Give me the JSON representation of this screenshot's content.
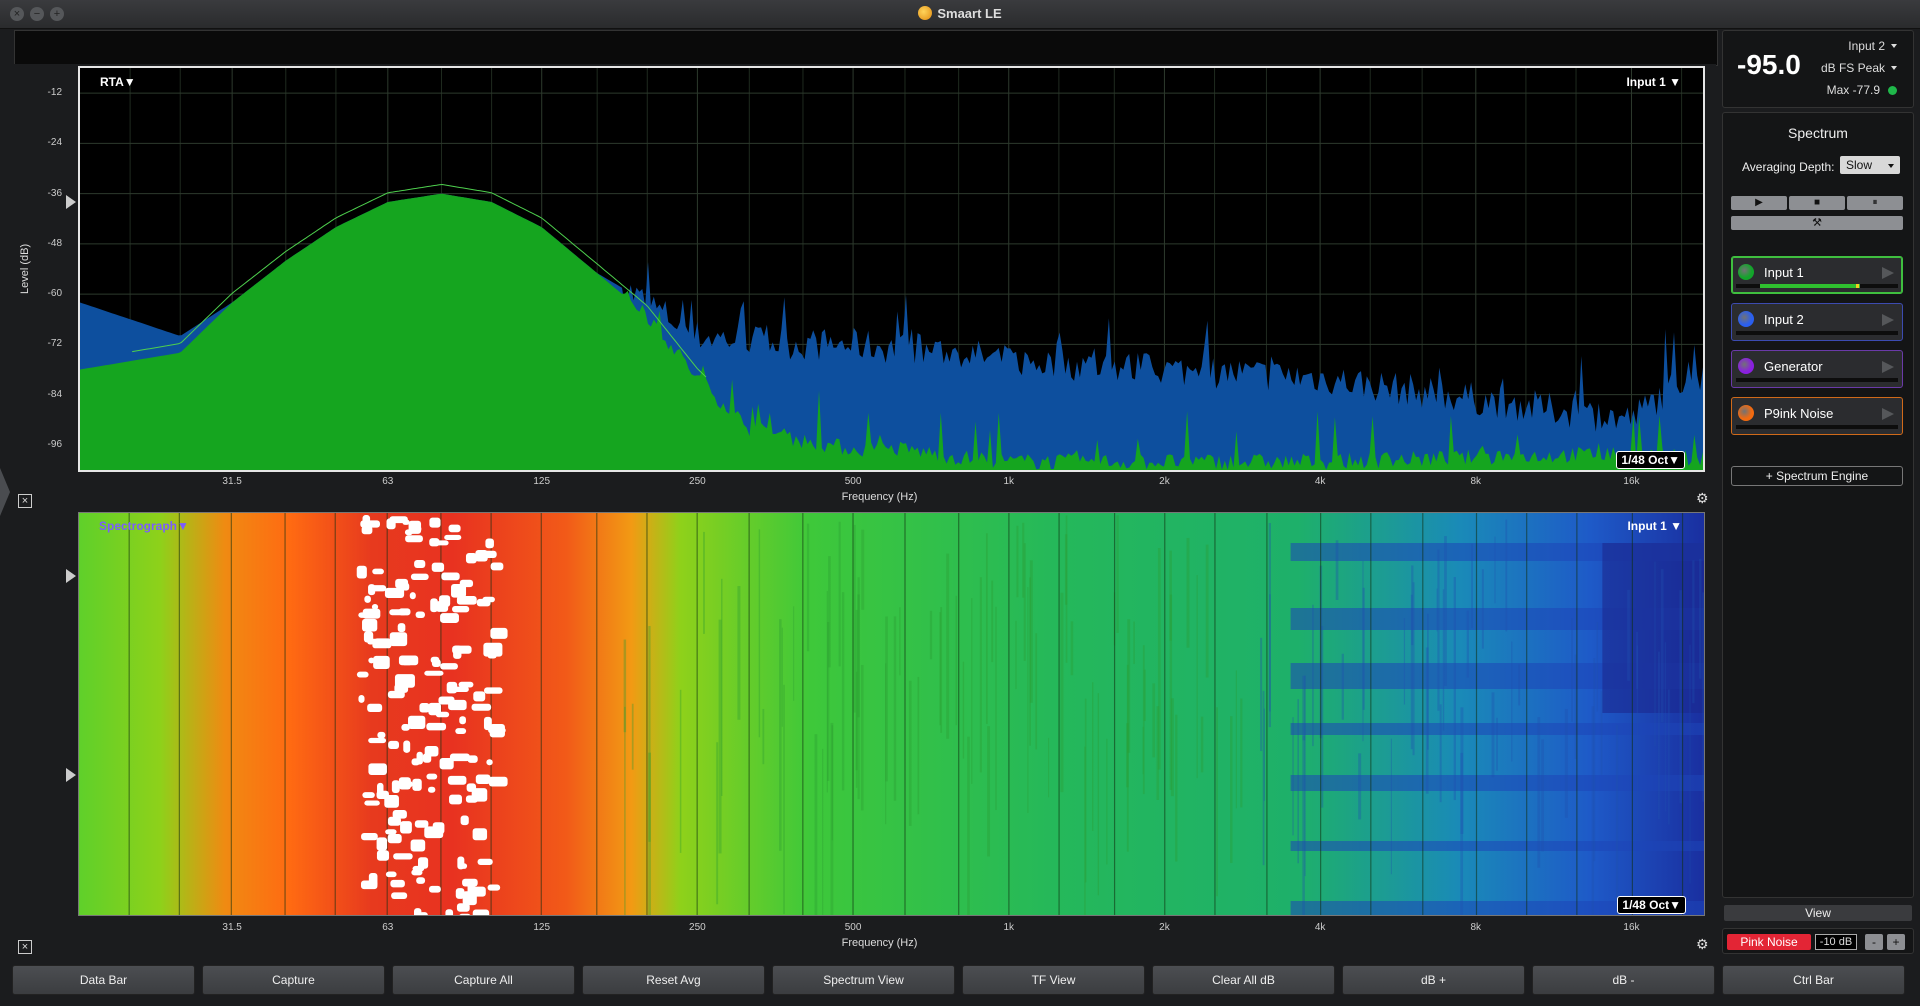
{
  "app": {
    "title": "Smaart LE"
  },
  "rta": {
    "mode_label": "RTA▼",
    "input_label": "Input 1 ▼",
    "resolution_label": "1/48 Oct▼",
    "y_axis_title": "Level (dB)",
    "x_axis_title": "Frequency (Hz)",
    "y_ticks": [
      "-12",
      "-24",
      "-36",
      "-48",
      "-60",
      "-72",
      "-84",
      "-96"
    ],
    "x_ticks": [
      "31.5",
      "63",
      "125",
      "250",
      "500",
      "1k",
      "2k",
      "4k",
      "8k",
      "16k"
    ]
  },
  "spectrograph": {
    "mode_label": "Spectrograph▼",
    "input_label": "Input 1 ▼",
    "resolution_label": "1/48 Oct▼",
    "x_axis_title": "Frequency (Hz)",
    "x_ticks": [
      "31.5",
      "63",
      "125",
      "250",
      "500",
      "1k",
      "2k",
      "4k",
      "8k",
      "16k"
    ]
  },
  "chart_data": [
    {
      "type": "area",
      "title": "RTA",
      "xlabel": "Frequency (Hz)",
      "ylabel": "Level (dB)",
      "xscale": "log",
      "xlim": [
        16,
        22000
      ],
      "ylim": [
        -102,
        -6
      ],
      "grid": true,
      "series": [
        {
          "name": "Input 1",
          "color": "#15a51f",
          "x": [
            16,
            25,
            31.5,
            40,
            50,
            63,
            80,
            100,
            125,
            160,
            200,
            250,
            315,
            400,
            500,
            630,
            800,
            1000,
            2000,
            4000,
            8000,
            16000,
            20000
          ],
          "values": [
            -78,
            -74,
            -62,
            -52,
            -44,
            -38,
            -36,
            -38,
            -44,
            -55,
            -65,
            -80,
            -92,
            -95,
            -97,
            -97,
            -99,
            -100,
            -100,
            -100,
            -99,
            -98,
            -99
          ]
        },
        {
          "name": "Input 2",
          "color": "#0d4f9e",
          "x": [
            16,
            25,
            31.5,
            40,
            50,
            63,
            80,
            100,
            125,
            160,
            200,
            250,
            315,
            400,
            500,
            630,
            800,
            1000,
            2000,
            4000,
            8000,
            16000,
            20000
          ],
          "values": [
            -62,
            -70,
            -62,
            -52,
            -44,
            -38,
            -36,
            -38,
            -44,
            -55,
            -62,
            -70,
            -71,
            -72,
            -72,
            -73,
            -74,
            -76,
            -78,
            -80,
            -85,
            -90,
            -80
          ]
        }
      ]
    },
    {
      "type": "heatmap",
      "title": "Spectrograph",
      "xlabel": "Frequency (Hz)",
      "xscale": "log",
      "xlim": [
        16,
        22000
      ],
      "x": [
        16,
        31.5,
        50,
        63,
        80,
        100,
        125,
        160,
        200,
        250,
        500,
        1000,
        2000,
        4000,
        8000,
        16000,
        20000
      ],
      "level_db": [
        -60,
        -50,
        -40,
        -33,
        -30,
        -36,
        -40,
        -45,
        -52,
        -60,
        -64,
        -66,
        -68,
        -72,
        -76,
        -84,
        -82
      ],
      "colors": [
        "#1a2fa0",
        "#1a8fd8",
        "#18c070",
        "#7ad11a",
        "#ff7a10",
        "#e83020",
        "#ffffff"
      ]
    }
  ],
  "meter": {
    "value": "-95.0",
    "input_label": "Input 2",
    "type_label": "dB FS Peak",
    "max_label": "Max -77.9",
    "max_color": "#1fb84a"
  },
  "spectrum_panel": {
    "title": "Spectrum",
    "averaging_label": "Averaging Depth:",
    "averaging_value": "Slow",
    "play_icon": "▶",
    "stop_icon": "■",
    "pause_icon": "⏸",
    "tools_icon": "⚒",
    "engines": [
      {
        "name": "Input 1",
        "color": "#12a52a",
        "border": "#3fbf3f",
        "active": true
      },
      {
        "name": "Input 2",
        "color": "#2a5ff0",
        "border": "#3c4bb0",
        "active": false
      },
      {
        "name": "Generator",
        "color": "#8a1fe0",
        "border": "#6a3aa8",
        "active": false
      },
      {
        "name": "P9ink Noise",
        "color": "#f26a10",
        "border": "#d06a1a",
        "active": false
      }
    ],
    "add_engine_label": "+ Spectrum Engine"
  },
  "view_label": "View",
  "generator": {
    "pink_label": "Pink Noise",
    "level": "-10 dB",
    "minus": "-",
    "plus": "+"
  },
  "bottom_buttons": [
    "Data Bar",
    "Capture",
    "Capture All",
    "Reset Avg",
    "Spectrum View",
    "TF View",
    "Clear All dB",
    "dB +",
    "dB -",
    "Ctrl Bar"
  ],
  "colors": {
    "accent_green": "#15a51f",
    "accent_blue": "#0d4f9e",
    "pink_noise_red": "#e32535"
  }
}
